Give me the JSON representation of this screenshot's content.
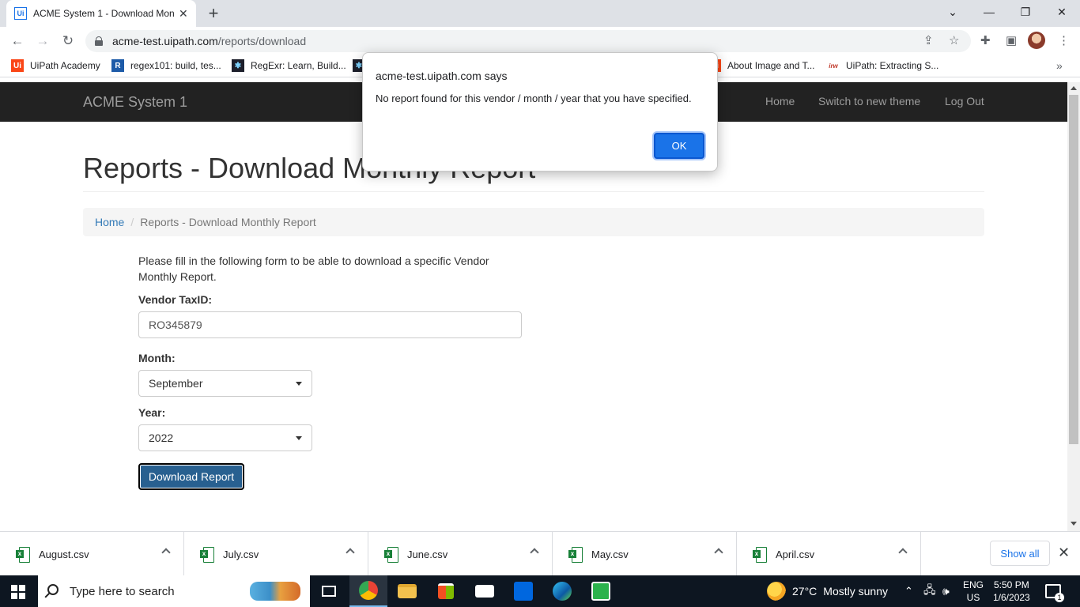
{
  "browser": {
    "tab_title": "ACME System 1 - Download Mon",
    "tab_favicon": "Ui",
    "url_host": "acme-test.uipath.com",
    "url_path": "/reports/download",
    "bookmarks": [
      {
        "label": "UiPath Academy",
        "icon": "uipath-icon",
        "color": "#fa4616",
        "glyph": "Ui"
      },
      {
        "label": "regex101: build, tes...",
        "icon": "regex101-icon",
        "color": "#1e5ba8",
        "glyph": "R"
      },
      {
        "label": "RegExr: Learn, Build...",
        "icon": "regexr-icon",
        "color": "#1d1f2b",
        "glyph": "✱"
      },
      {
        "label": "",
        "icon": "regexr-icon",
        "color": "#1d1f2b",
        "glyph": "✱"
      },
      {
        "label": "About Image and T...",
        "icon": "uipath-icon",
        "color": "#fa4616",
        "glyph": "Ui"
      },
      {
        "label": "UiPath: Extracting S...",
        "icon": "irw-icon",
        "color": "#ffffff",
        "glyph": "irw"
      }
    ]
  },
  "app": {
    "brand": "ACME System 1",
    "nav": [
      "Home",
      "Switch to new theme",
      "Log Out"
    ],
    "page_title": "Reports - Download Monthly Report",
    "breadcrumb": {
      "home": "Home",
      "current": "Reports - Download Monthly Report"
    },
    "intro": "Please fill in the following form to be able to download a specific Vendor Monthly Report.",
    "form": {
      "vendor_label": "Vendor TaxID:",
      "vendor_value": "RO345879",
      "month_label": "Month:",
      "month_value": "September",
      "year_label": "Year:",
      "year_value": "2022",
      "submit": "Download Report"
    }
  },
  "dialog": {
    "title": "acme-test.uipath.com says",
    "message": "No report found for this vendor / month / year that you have specified.",
    "ok": "OK"
  },
  "downloads": {
    "files": [
      "August.csv",
      "July.csv",
      "June.csv",
      "May.csv",
      "April.csv"
    ],
    "show_all": "Show all"
  },
  "taskbar": {
    "search_placeholder": "Type here to search",
    "weather_temp": "27°C",
    "weather_desc": "Mostly sunny",
    "lang_top": "ENG",
    "lang_bottom": "US",
    "time": "5:50 PM",
    "date": "1/6/2023",
    "notifications": "1"
  },
  "colors": {
    "navbar": "#222222",
    "primary_button": "#286090",
    "dialog_button": "#1a73e8",
    "link": "#337ab7"
  }
}
